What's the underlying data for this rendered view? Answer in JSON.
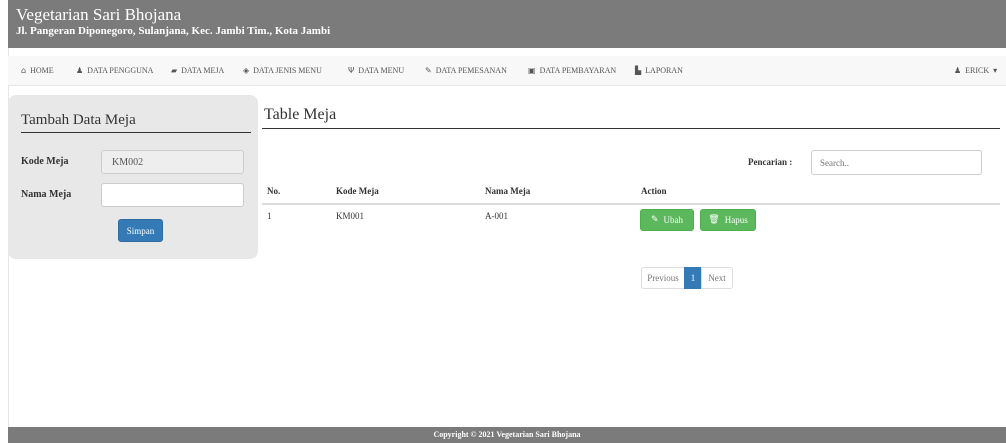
{
  "header": {
    "title": "Vegetarian Sari Bhojana",
    "address": "Jl. Pangeran Diponegoro, Sulanjana, Kec. Jambi Tim., Kota Jambi"
  },
  "nav": {
    "items": [
      {
        "label": "HOME",
        "icon": "home-icon",
        "glyph": "⌂"
      },
      {
        "label": "DATA PENGGUNA",
        "icon": "user-icon",
        "glyph": "♟"
      },
      {
        "label": "DATA MEJA",
        "icon": "table-icon",
        "glyph": "▰"
      },
      {
        "label": "DATA JENIS MENU",
        "icon": "tag-icon",
        "glyph": "◈"
      },
      {
        "label": "DATA MENU",
        "icon": "cutlery-icon",
        "glyph": "Ψ"
      },
      {
        "label": "DATA PEMESANAN",
        "icon": "pencil-icon",
        "glyph": "✎"
      },
      {
        "label": "DATA PEMBAYARAN",
        "icon": "payment-icon",
        "glyph": "▣"
      },
      {
        "label": "LAPORAN",
        "icon": "report-icon",
        "glyph": "▙"
      }
    ],
    "user": {
      "label": "ERICK",
      "icon": "user-icon",
      "glyph": "♟",
      "caret": "▾"
    }
  },
  "form": {
    "title": "Tambah Data Meja",
    "kode_label": "Kode Meja",
    "kode_value": "KM002",
    "nama_label": "Nama Meja",
    "nama_value": "",
    "submit_label": "Simpan"
  },
  "table": {
    "title": "Table Meja",
    "search_label": "Pencarian :",
    "search_placeholder": "Search..",
    "columns": [
      "No.",
      "Kode Meja",
      "Nama Meja",
      "Action"
    ],
    "rows": [
      {
        "no": "1",
        "kode": "KM001",
        "nama": "A-001",
        "edit_label": "Ubah",
        "delete_label": "Hapus"
      }
    ],
    "pagination": {
      "previous": "Previous",
      "current": "1",
      "next": "Next"
    }
  },
  "footer": {
    "text": "Copyright © 2021 Vegetarian Sari Bhojana"
  },
  "colors": {
    "header_bg": "#7b7b7b",
    "primary": "#337ab7",
    "success": "#5cb85c",
    "panel_bg": "#e8e8e8"
  }
}
